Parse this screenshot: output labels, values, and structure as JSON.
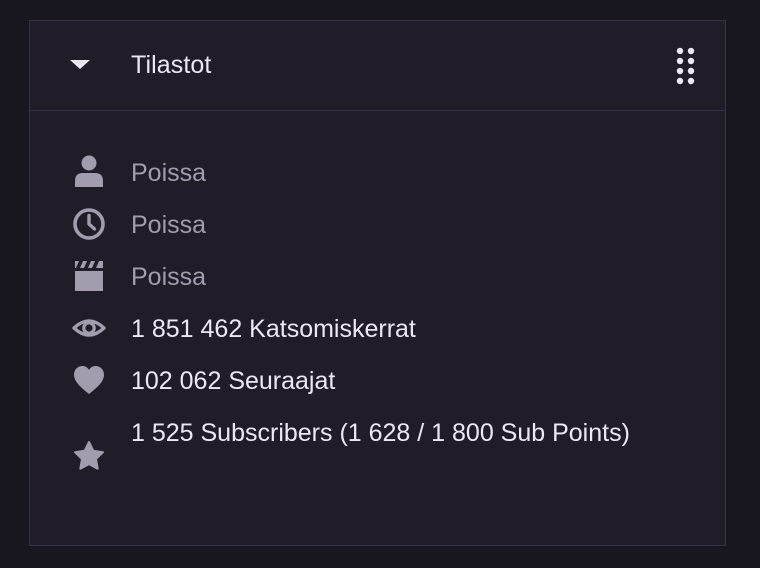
{
  "panel": {
    "title": "Tilastot",
    "toggle_icon": "caret-down-icon",
    "handle_icon": "drag-handle-icon"
  },
  "colors": {
    "page_background": "#18161f",
    "panel_background": "#201d29",
    "border": "#37324a",
    "text_primary": "#ece9f3",
    "text_muted": "#a29cae",
    "icon": "#a29cae"
  },
  "stats": [
    {
      "icon": "person-icon",
      "text": "Poissa",
      "muted": true
    },
    {
      "icon": "clock-icon",
      "text": "Poissa",
      "muted": true
    },
    {
      "icon": "clapperboard-icon",
      "text": "Poissa",
      "muted": true
    },
    {
      "icon": "eye-icon",
      "text": "1 851 462 Katsomiskerrat",
      "muted": false
    },
    {
      "icon": "heart-icon",
      "text": "102 062 Seuraajat",
      "muted": false
    },
    {
      "icon": "star-icon",
      "text": "1 525 Subscribers (1 628 / 1 800 Sub Points)",
      "muted": false
    }
  ]
}
